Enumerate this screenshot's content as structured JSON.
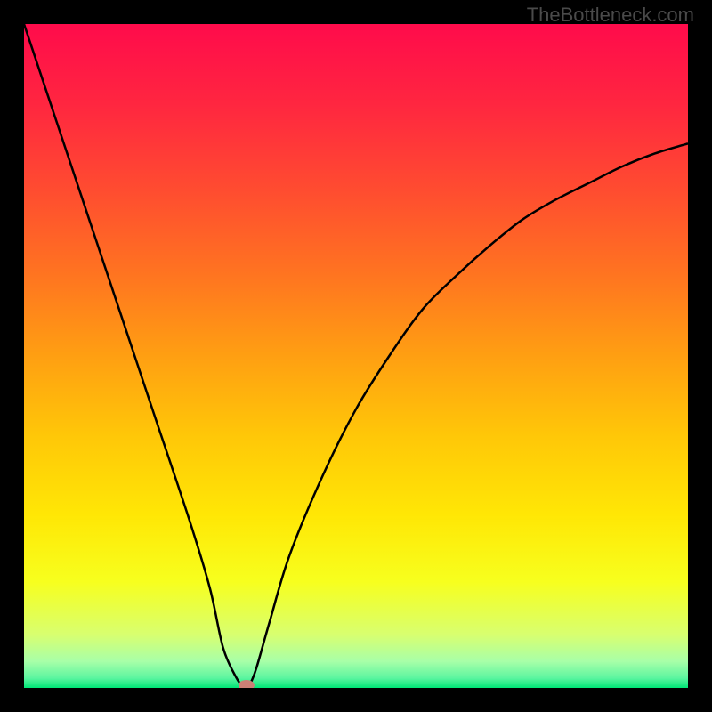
{
  "watermark": "TheBottleneck.com",
  "chart_data": {
    "type": "line",
    "title": "",
    "xlabel": "",
    "ylabel": "",
    "xlim": [
      0,
      100
    ],
    "ylim": [
      0,
      100
    ],
    "x": [
      0,
      5,
      10,
      15,
      20,
      25,
      28,
      30,
      32,
      33,
      33.5,
      34,
      35,
      37,
      40,
      45,
      50,
      55,
      60,
      65,
      70,
      75,
      80,
      85,
      90,
      95,
      100
    ],
    "y": [
      100,
      85,
      70,
      55,
      40,
      25,
      15,
      6,
      1.5,
      0.3,
      0,
      0.5,
      3,
      10,
      20,
      32,
      42,
      50,
      57,
      62,
      66.5,
      70.5,
      73.5,
      76,
      78.5,
      80.5,
      82
    ],
    "marker": {
      "x": 33.5,
      "y": 0
    },
    "gradient_stops": [
      {
        "pos": 0.0,
        "color": "#ff0b4b"
      },
      {
        "pos": 0.12,
        "color": "#ff2640"
      },
      {
        "pos": 0.25,
        "color": "#ff4c30"
      },
      {
        "pos": 0.38,
        "color": "#ff7520"
      },
      {
        "pos": 0.5,
        "color": "#ff9f12"
      },
      {
        "pos": 0.62,
        "color": "#ffc708"
      },
      {
        "pos": 0.74,
        "color": "#ffe705"
      },
      {
        "pos": 0.84,
        "color": "#f7ff1e"
      },
      {
        "pos": 0.92,
        "color": "#d8ff70"
      },
      {
        "pos": 0.96,
        "color": "#a8ffa8"
      },
      {
        "pos": 0.985,
        "color": "#5cf5a0"
      },
      {
        "pos": 1.0,
        "color": "#00e676"
      }
    ]
  }
}
